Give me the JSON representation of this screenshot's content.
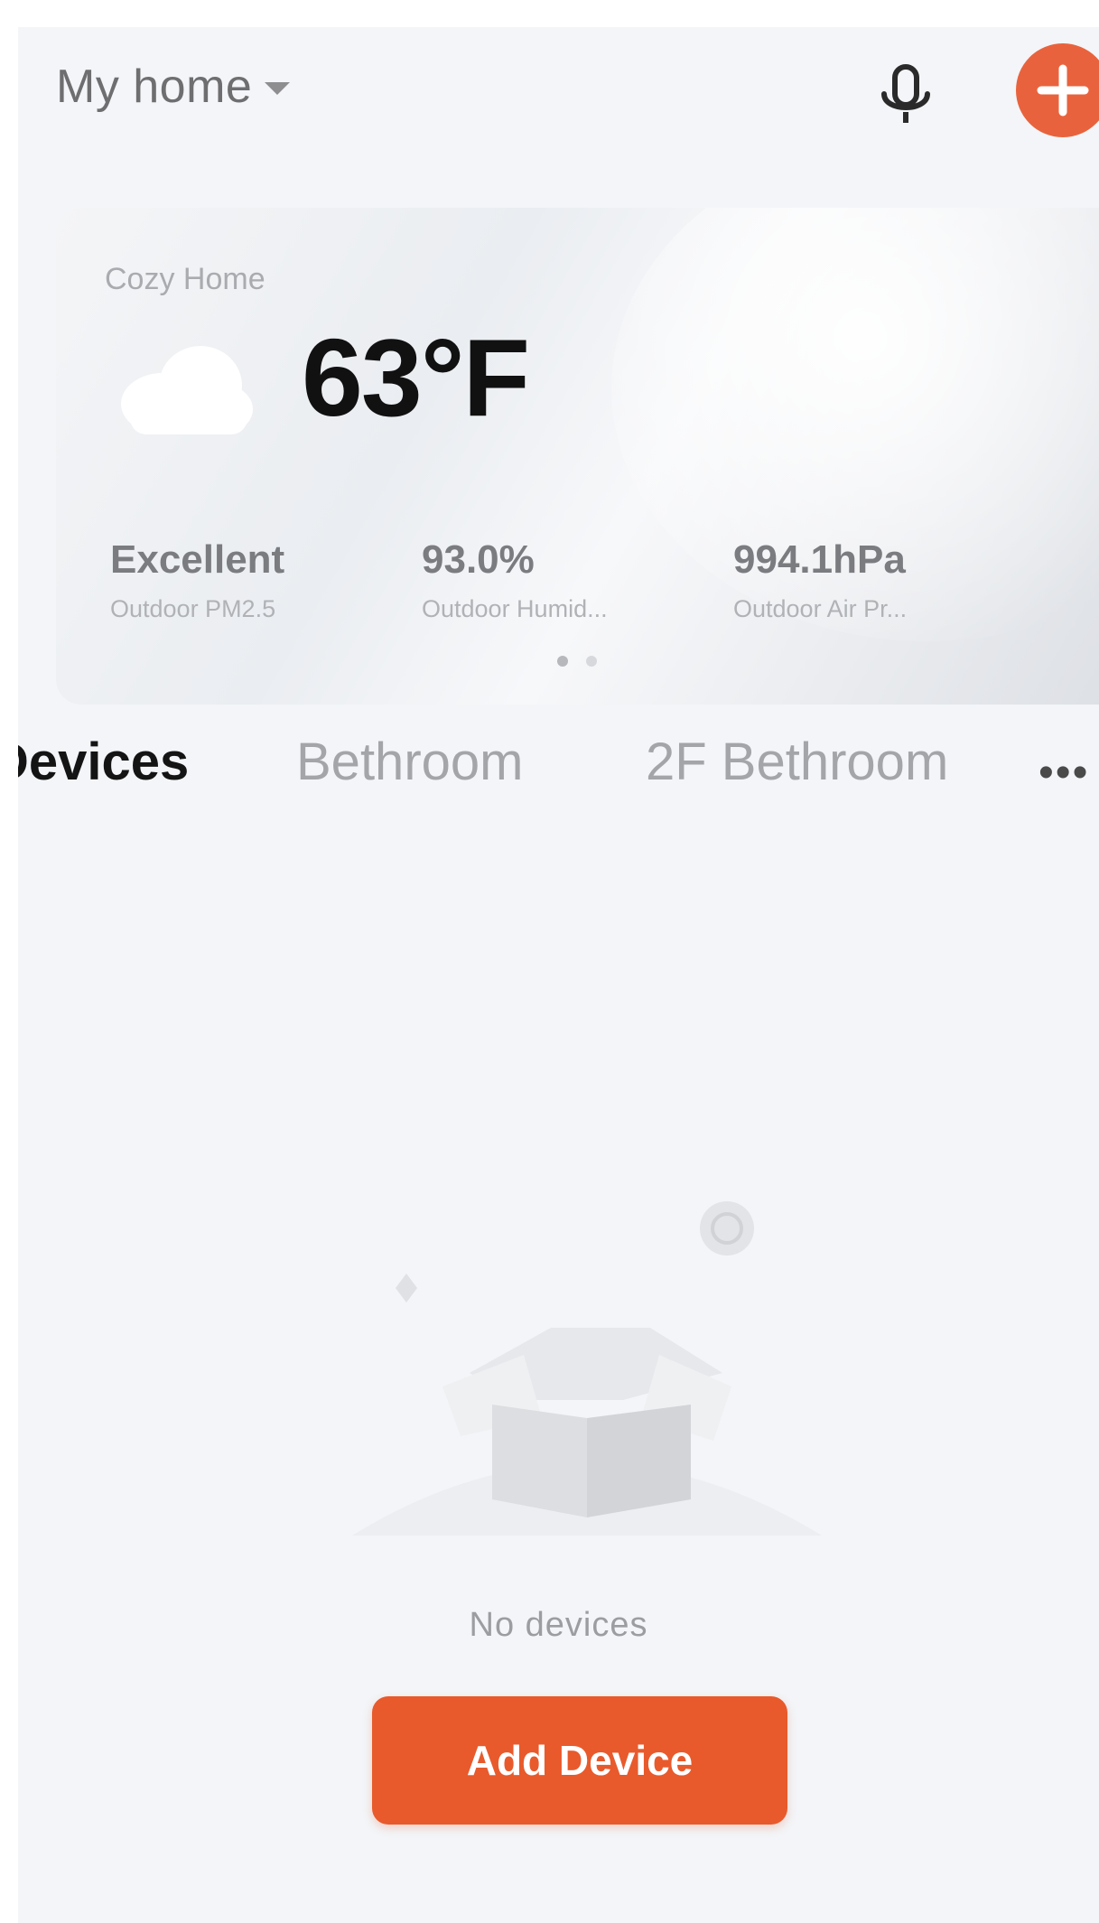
{
  "header": {
    "home_name": "My home",
    "mic_icon": "microphone-icon",
    "add_icon": "plus-icon",
    "accent_color": "#e8633d"
  },
  "weather_card": {
    "title": "Cozy Home",
    "weather_icon": "cloud-icon",
    "temperature": "63°F",
    "stats": [
      {
        "value": "Excellent",
        "label": "Outdoor PM2.5"
      },
      {
        "value": "93.0%",
        "label": "Outdoor Humid..."
      },
      {
        "value": "994.1hPa",
        "label": "Outdoor Air Pr..."
      }
    ],
    "page_indicator": {
      "count": 2,
      "active": 1
    }
  },
  "tabs": {
    "items": [
      {
        "label": "Devices",
        "active": true
      },
      {
        "label": "Bethroom",
        "active": false
      },
      {
        "label": "2F Bethroom",
        "active": false
      }
    ],
    "more_label": "•••"
  },
  "empty_state": {
    "illustration": "empty-box-icon",
    "message": "No devices",
    "button_label": "Add Device",
    "button_color": "#e85a2c"
  }
}
